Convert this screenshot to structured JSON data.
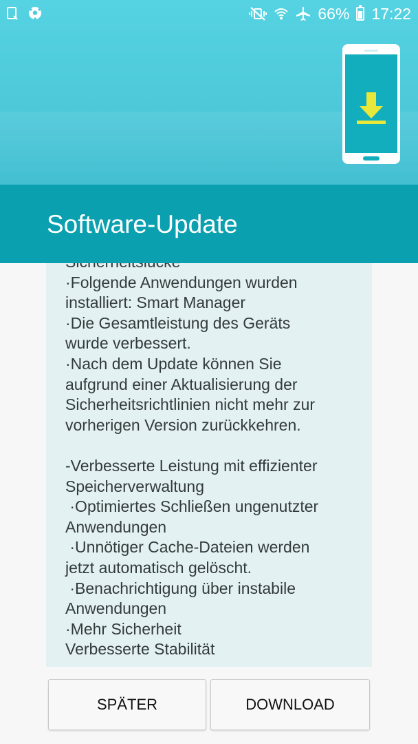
{
  "status_bar": {
    "left_icons": [
      "notification-icon",
      "soccer-ball-icon"
    ],
    "right_icons": [
      "mute-vibrate-icon",
      "wifi-icon",
      "airplane-icon",
      "battery-icon"
    ],
    "battery_percent": "66%",
    "time": "17:22",
    "battery_level": 0.66
  },
  "header": {
    "title": "Software-Update",
    "illustration": "phone-download-icon",
    "colors": {
      "hero": "#4dc9da",
      "title_bar": "#0aa0b0",
      "download_arrow": "#e8e83a"
    }
  },
  "release_notes": {
    "lines": [
      "Sicherheitslücke",
      "·Folgende Anwendungen wurden",
      "installiert: Smart Manager",
      "·Die Gesamtleistung des Geräts",
      "wurde verbessert.",
      "·Nach dem Update können Sie",
      "aufgrund einer Aktualisierung der",
      "Sicherheitsrichtlinien nicht mehr zur",
      "vorherigen Version zurückkehren.",
      "",
      "-Verbesserte Leistung mit effizienter",
      "Speicherverwaltung",
      " ·Optimiertes Schließen ungenutzter",
      "Anwendungen",
      " ·Unnötiger Cache-Dateien werden",
      "jetzt automatisch gelöscht.",
      " ·Benachrichtigung über instabile",
      "Anwendungen",
      "·Mehr Sicherheit",
      "Verbesserte Stabilität"
    ]
  },
  "buttons": {
    "later_label": "SPÄTER",
    "download_label": "DOWNLOAD"
  }
}
